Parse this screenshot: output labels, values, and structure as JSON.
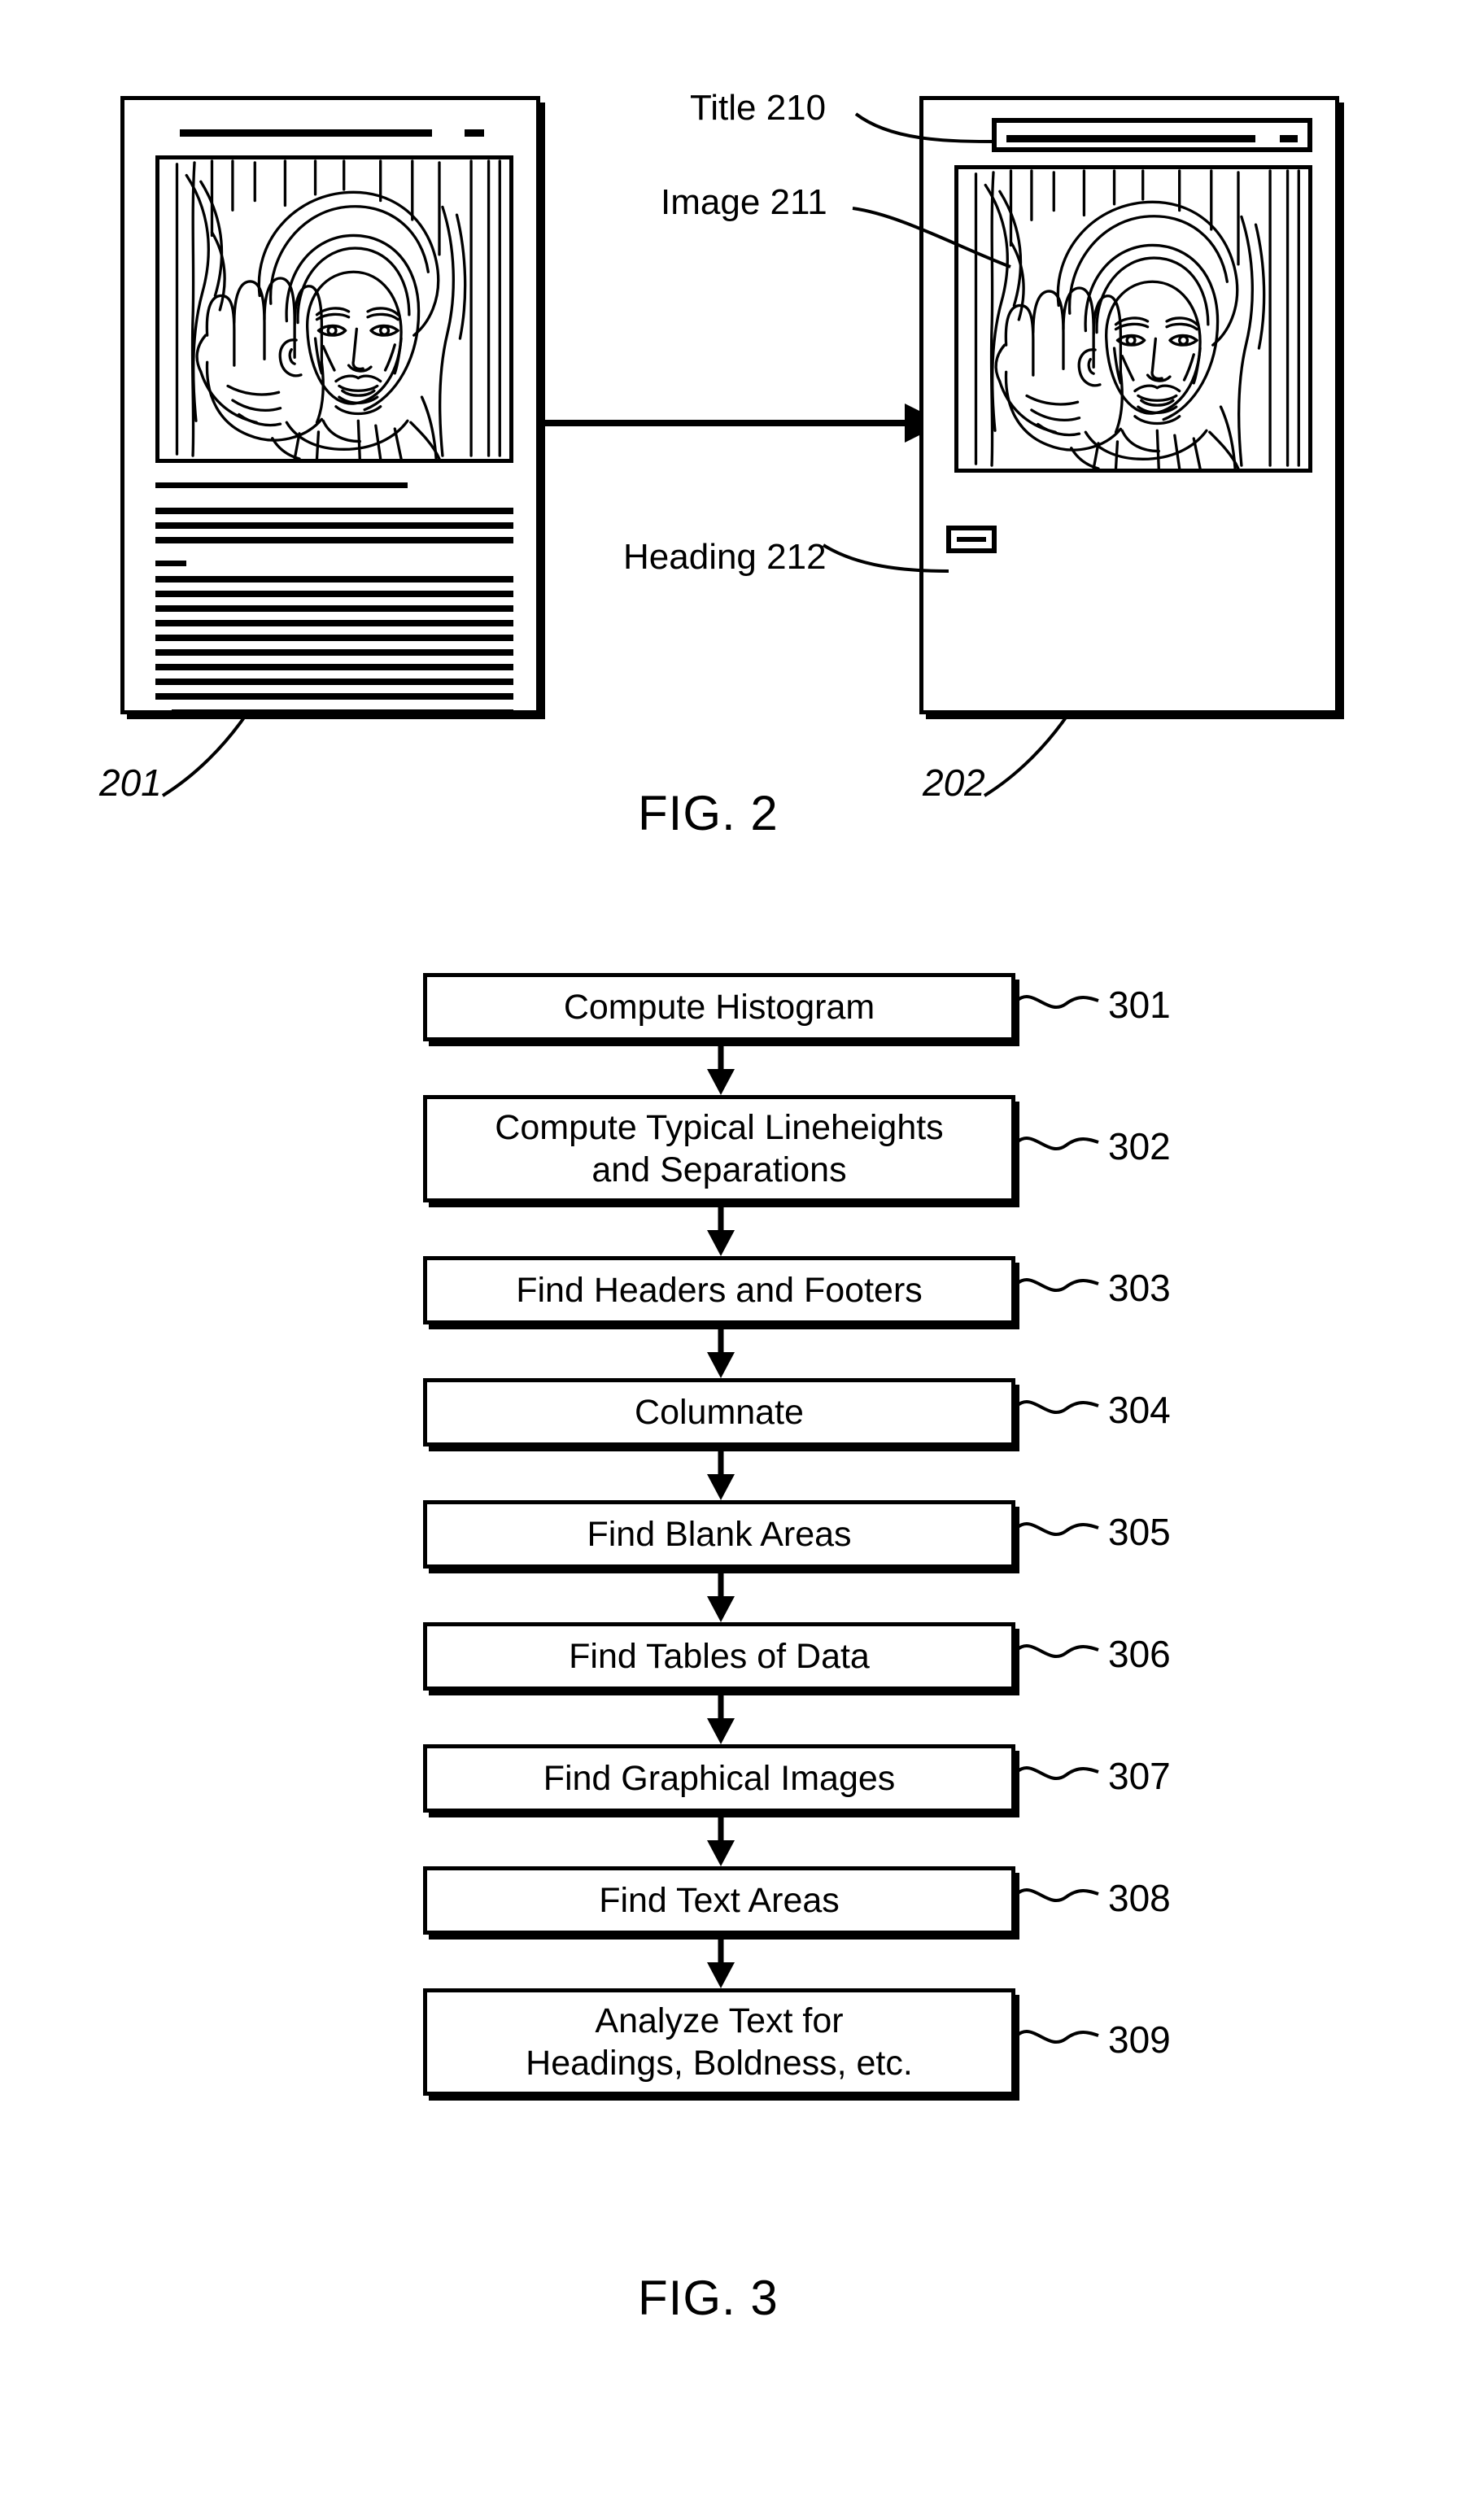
{
  "figures": [
    {
      "id": "fig2",
      "caption": "FIG. 2",
      "documents": [
        {
          "ref": "201",
          "role": "scanned-source-document"
        },
        {
          "ref": "202",
          "role": "analyzed-output-document"
        }
      ],
      "callouts": [
        {
          "label": "Title 210",
          "target": "title-bar"
        },
        {
          "label": "Image 211",
          "target": "image-frame"
        },
        {
          "label": "Heading 212",
          "target": "heading-chip"
        }
      ]
    },
    {
      "id": "fig3",
      "caption": "FIG. 3"
    }
  ],
  "fig2": {
    "caption": "FIG. 2",
    "doc_left": {
      "ref": "201",
      "title_rule": "",
      "body_line_groups": [
        {
          "lines": [
            {
              "width_pct": 62
            }
          ]
        },
        {
          "lines": [
            {
              "width_pct": 100
            },
            {
              "width_pct": 100
            },
            {
              "width_pct": 100
            }
          ]
        },
        {
          "lines": [
            {
              "width_pct": 9
            }
          ]
        },
        {
          "lines": [
            {
              "width_pct": 100
            },
            {
              "width_pct": 100
            },
            {
              "width_pct": 100
            },
            {
              "width_pct": 100
            },
            {
              "width_pct": 100
            },
            {
              "width_pct": 100
            },
            {
              "width_pct": 100
            },
            {
              "width_pct": 100
            },
            {
              "width_pct": 100
            },
            {
              "width_pct": 96
            }
          ]
        }
      ]
    },
    "doc_right": {
      "ref": "202",
      "title_box_label": "",
      "heading_chip_label": ""
    },
    "labels": {
      "title": "Title 210",
      "image": "Image 211",
      "heading": "Heading 212"
    },
    "arrow": {
      "direction": "right",
      "from": "201",
      "to": "202"
    }
  },
  "fig3": {
    "caption": "FIG. 3",
    "steps": [
      {
        "ref": "301",
        "label": "Compute Histogram",
        "lines": [
          "Compute Histogram"
        ]
      },
      {
        "ref": "302",
        "label": "Compute Typical Lineheights and Separations",
        "lines": [
          "Compute Typical Lineheights",
          "and Separations"
        ]
      },
      {
        "ref": "303",
        "label": "Find Headers and Footers",
        "lines": [
          "Find Headers and Footers"
        ]
      },
      {
        "ref": "304",
        "label": "Columnate",
        "lines": [
          "Columnate"
        ]
      },
      {
        "ref": "305",
        "label": "Find Blank Areas",
        "lines": [
          "Find Blank Areas"
        ]
      },
      {
        "ref": "306",
        "label": "Find Tables of Data",
        "lines": [
          "Find Tables of Data"
        ]
      },
      {
        "ref": "307",
        "label": "Find Graphical Images",
        "lines": [
          "Find Graphical Images"
        ]
      },
      {
        "ref": "308",
        "label": "Find Text Areas",
        "lines": [
          "Find Text Areas"
        ]
      },
      {
        "ref": "309",
        "label": "Analyze Text for Headings, Boldness, etc.",
        "lines": [
          "Analyze Text for",
          "Headings, Boldness, etc."
        ]
      }
    ]
  },
  "colors": {
    "ink": "#000000",
    "paper": "#ffffff"
  }
}
